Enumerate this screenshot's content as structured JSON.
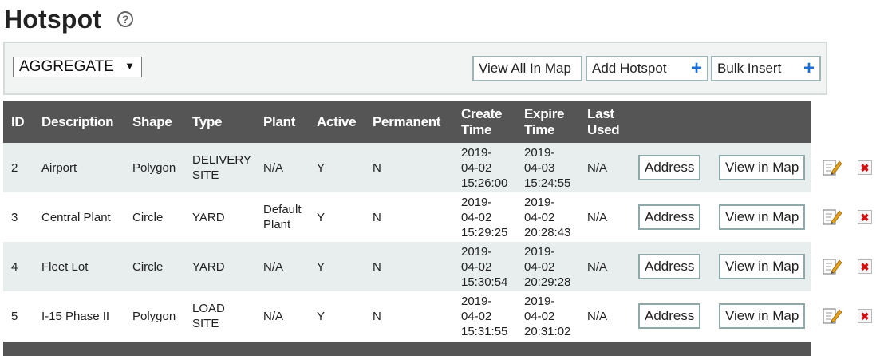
{
  "page": {
    "title": "Hotspot",
    "help_icon": "?"
  },
  "toolbar": {
    "select_value": "AGGREGATE",
    "view_all_label": "View All In Map",
    "add_label": "Add Hotspot",
    "bulk_label": "Bulk Insert",
    "plus_glyph": "+"
  },
  "table": {
    "headers": {
      "id": "ID",
      "description": "Description",
      "shape": "Shape",
      "type": "Type",
      "plant": "Plant",
      "active": "Active",
      "permanent": "Permanent",
      "create_1": "Create",
      "create_2": "Time",
      "expire_1": "Expire",
      "expire_2": "Time",
      "last_1": "Last",
      "last_2": "Used"
    },
    "rows": [
      {
        "id": "2",
        "description": "Airport",
        "shape": "Polygon",
        "type_1": "DELIVERY",
        "type_2": "SITE",
        "plant_1": "N/A",
        "plant_2": "",
        "active": "Y",
        "permanent": "N",
        "create_1": "2019-",
        "create_2": "04-02",
        "create_3": "15:26:00",
        "expire_1": "2019-",
        "expire_2": "04-03",
        "expire_3": "15:24:55",
        "last_used": "N/A",
        "address_label": "Address",
        "view_label": "View in Map"
      },
      {
        "id": "3",
        "description": "Central Plant",
        "shape": "Circle",
        "type_1": "YARD",
        "type_2": "",
        "plant_1": "Default",
        "plant_2": "Plant",
        "active": "Y",
        "permanent": "N",
        "create_1": "2019-",
        "create_2": "04-02",
        "create_3": "15:29:25",
        "expire_1": "2019-",
        "expire_2": "04-02",
        "expire_3": "20:28:43",
        "last_used": "N/A",
        "address_label": "Address",
        "view_label": "View in Map"
      },
      {
        "id": "4",
        "description": "Fleet Lot",
        "shape": "Circle",
        "type_1": "YARD",
        "type_2": "",
        "plant_1": "N/A",
        "plant_2": "",
        "active": "Y",
        "permanent": "N",
        "create_1": "2019-",
        "create_2": "04-02",
        "create_3": "15:30:54",
        "expire_1": "2019-",
        "expire_2": "04-02",
        "expire_3": "20:29:28",
        "last_used": "N/A",
        "address_label": "Address",
        "view_label": "View in Map"
      },
      {
        "id": "5",
        "description": "I-15 Phase II",
        "shape": "Polygon",
        "type_1": "LOAD",
        "type_2": "SITE",
        "plant_1": "N/A",
        "plant_2": "",
        "active": "Y",
        "permanent": "N",
        "create_1": "2019-",
        "create_2": "04-02",
        "create_3": "15:31:55",
        "expire_1": "2019-",
        "expire_2": "04-02",
        "expire_3": "20:31:02",
        "last_used": "N/A",
        "address_label": "Address",
        "view_label": "View in Map"
      }
    ]
  },
  "icons": {
    "edit": "edit-icon",
    "delete": "delete-icon",
    "delete_glyph": "✖",
    "edit_color": "#e0a020",
    "delete_color": "#d01010",
    "accent": "#1a6fd8"
  }
}
